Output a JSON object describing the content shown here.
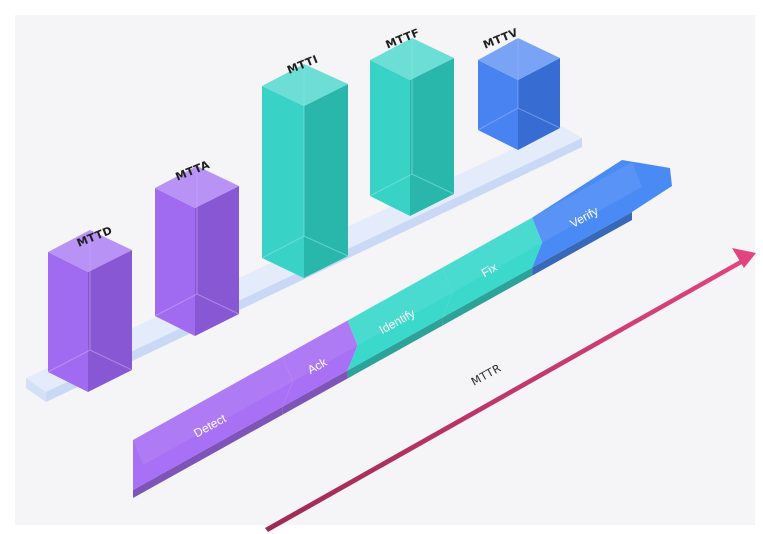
{
  "metrics": [
    {
      "label": "MTTD",
      "color": "#9b63f0"
    },
    {
      "label": "MTTA",
      "color": "#9b63f0"
    },
    {
      "label": "MTTI",
      "color": "#2fd0c3"
    },
    {
      "label": "MTTF",
      "color": "#2fd0c3"
    },
    {
      "label": "MTTV",
      "color": "#3f7bf0"
    }
  ],
  "steps": [
    {
      "label": "Detect",
      "color": "#a870f5"
    },
    {
      "label": "Ack",
      "color": "#a870f5"
    },
    {
      "label": "Identify",
      "color": "#3bd8cc"
    },
    {
      "label": "Fix",
      "color": "#3bd8cc"
    },
    {
      "label": "Verify",
      "color": "#4a8af5"
    }
  ],
  "overall": {
    "label": "MTTR",
    "color": "#c8366d"
  }
}
